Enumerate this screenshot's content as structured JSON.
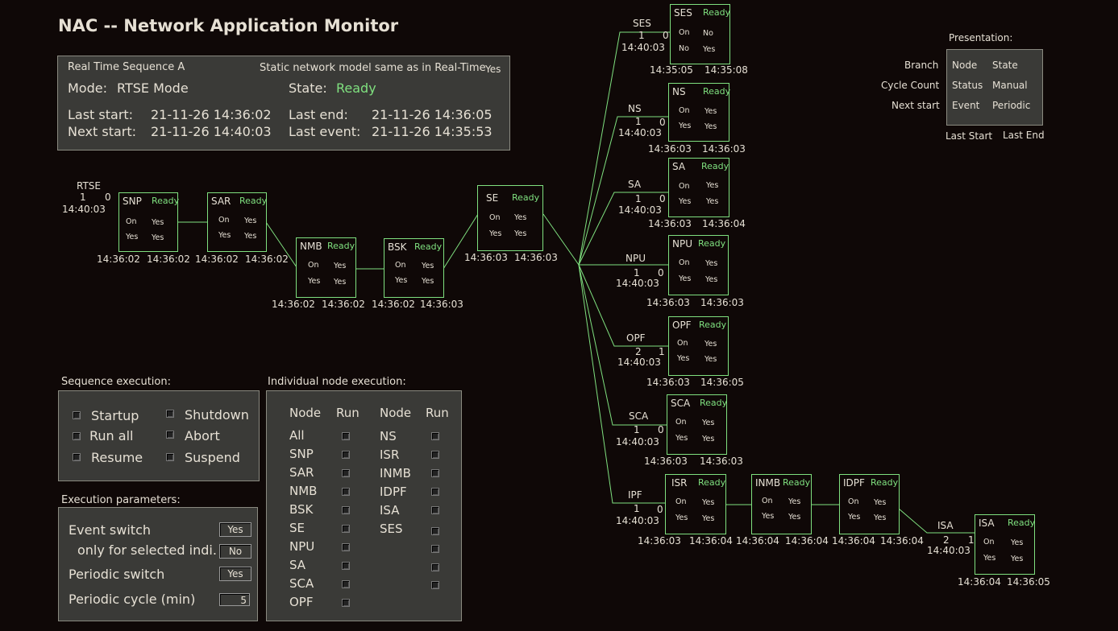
{
  "title": "NAC -- Network Application Monitor",
  "info": {
    "sequence": "Real Time Sequence A",
    "static_label": "Static network model same as in Real-Time",
    "static_value": "Yes",
    "mode_label": "Mode:",
    "mode_value": "RTSE Mode",
    "state_label": "State:",
    "state_value": "Ready",
    "last_start_label": "Last start:",
    "last_start_value": "21-11-26 14:36:02",
    "last_end_label": "Last end:",
    "last_end_value": "21-11-26 14:36:05",
    "next_start_label": "Next start:",
    "next_start_value": "21-11-26 14:40:03",
    "last_event_label": "Last event:",
    "last_event_value": "21-11-26 14:35:53"
  },
  "presentation": {
    "label": "Presentation:",
    "left_labels": [
      "Branch",
      "Cycle Count",
      "Next start"
    ],
    "col1": [
      "Node",
      "Status",
      "Event"
    ],
    "col2": [
      "State",
      "Manual",
      "Periodic"
    ],
    "bottom1": "Last Start",
    "bottom2": "Last End"
  },
  "rtse": {
    "name": "RTSE",
    "c1": "1",
    "c2": "0",
    "time": "14:40:03"
  },
  "nodes": {
    "snp": {
      "name": "SNP",
      "status": "Ready",
      "v1": "On",
      "v2": "Yes",
      "v3": "Yes",
      "v4": "Yes",
      "t1": "14:36:02",
      "t2": "14:36:02"
    },
    "sar": {
      "name": "SAR",
      "status": "Ready",
      "v1": "On",
      "v2": "Yes",
      "v3": "Yes",
      "v4": "Yes",
      "t1": "14:36:02",
      "t2": "14:36:02"
    },
    "nmb": {
      "name": "NMB",
      "status": "Ready",
      "v1": "On",
      "v2": "Yes",
      "v3": "Yes",
      "v4": "Yes",
      "t1": "14:36:02",
      "t2": "14:36:02"
    },
    "bsk": {
      "name": "BSK",
      "status": "Ready",
      "v1": "On",
      "v2": "Yes",
      "v3": "Yes",
      "v4": "Yes",
      "t1": "14:36:02",
      "t2": "14:36:03"
    },
    "se": {
      "name": "SE",
      "status": "Ready",
      "v1": "On",
      "v2": "Yes",
      "v3": "Yes",
      "v4": "Yes",
      "t1": "14:36:03",
      "t2": "14:36:03"
    },
    "ses": {
      "name": "SES",
      "status": "Ready",
      "v1": "On",
      "v2": "No",
      "v3": "No",
      "v4": "Yes",
      "t1": "14:35:05",
      "t2": "14:35:08",
      "branch": "SES",
      "c1": "1",
      "c2": "0",
      "next": "14:40:03"
    },
    "ns": {
      "name": "NS",
      "status": "Ready",
      "v1": "On",
      "v2": "Yes",
      "v3": "Yes",
      "v4": "Yes",
      "t1": "14:36:03",
      "t2": "14:36:03",
      "branch": "NS",
      "c1": "1",
      "c2": "0",
      "next": "14:40:03"
    },
    "sa": {
      "name": "SA",
      "status": "Ready",
      "v1": "On",
      "v2": "Yes",
      "v3": "Yes",
      "v4": "Yes",
      "t1": "14:36:03",
      "t2": "14:36:04",
      "branch": "SA",
      "c1": "1",
      "c2": "0",
      "next": "14:40:03"
    },
    "npu": {
      "name": "NPU",
      "status": "Ready",
      "v1": "On",
      "v2": "Yes",
      "v3": "Yes",
      "v4": "Yes",
      "t1": "14:36:03",
      "t2": "14:36:03",
      "branch": "NPU",
      "c1": "1",
      "c2": "0",
      "next": "14:40:03"
    },
    "opf": {
      "name": "OPF",
      "status": "Ready",
      "v1": "On",
      "v2": "Yes",
      "v3": "Yes",
      "v4": "Yes",
      "t1": "14:36:03",
      "t2": "14:36:05",
      "branch": "OPF",
      "c1": "2",
      "c2": "1",
      "next": "14:40:03"
    },
    "sca": {
      "name": "SCA",
      "status": "Ready",
      "v1": "On",
      "v2": "Yes",
      "v3": "Yes",
      "v4": "Yes",
      "t1": "14:36:03",
      "t2": "14:36:03",
      "branch": "SCA",
      "c1": "1",
      "c2": "0",
      "next": "14:40:03"
    },
    "isr": {
      "name": "ISR",
      "status": "Ready",
      "v1": "On",
      "v2": "Yes",
      "v3": "Yes",
      "v4": "Yes",
      "t1": "14:36:03",
      "t2": "14:36:04",
      "branch": "IPF",
      "c1": "1",
      "c2": "0",
      "next": "14:40:03"
    },
    "inmb": {
      "name": "INMB",
      "status": "Ready",
      "v1": "On",
      "v2": "Yes",
      "v3": "Yes",
      "v4": "Yes",
      "t1": "14:36:04",
      "t2": "14:36:04"
    },
    "idpf": {
      "name": "IDPF",
      "status": "Ready",
      "v1": "On",
      "v2": "Yes",
      "v3": "Yes",
      "v4": "Yes",
      "t1": "14:36:04",
      "t2": "14:36:04"
    },
    "isa": {
      "name": "ISA",
      "status": "Ready",
      "v1": "On",
      "v2": "Yes",
      "v3": "Yes",
      "v4": "Yes",
      "t1": "14:36:04",
      "t2": "14:36:05",
      "branch": "ISA",
      "c1": "2",
      "c2": "1",
      "next": "14:40:03"
    }
  },
  "seqexec": {
    "label": "Sequence execution:",
    "startup": "Startup",
    "run_all": "Run all",
    "resume": "Resume",
    "shutdown": "Shutdown",
    "abort": "Abort",
    "suspend": "Suspend"
  },
  "params": {
    "label": "Execution parameters:",
    "event_switch": "Event switch",
    "event_switch_val": "Yes",
    "only_selected": "only for selected indi.",
    "only_selected_val": "No",
    "periodic_switch": "Periodic switch",
    "periodic_switch_val": "Yes",
    "periodic_cycle": "Periodic cycle (min)",
    "periodic_cycle_val": "5"
  },
  "indiv": {
    "label": "Individual node execution:",
    "h_node": "Node",
    "h_run": "Run",
    "col1": [
      "All",
      "SNP",
      "SAR",
      "NMB",
      "BSK",
      "SE",
      "NPU",
      "SA",
      "SCA",
      "OPF"
    ],
    "col2": [
      "NS",
      "ISR",
      "INMB",
      "IDPF",
      "ISA",
      "SES"
    ]
  },
  "colors": {
    "background": "#0f0807",
    "panel": "#3a3a37",
    "ready": "#7fe07f",
    "text": "#e6e0d4"
  }
}
